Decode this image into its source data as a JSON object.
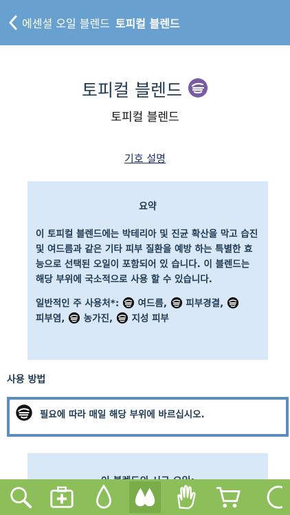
{
  "nav": {
    "back_label": "에센셜 오일 블렌드",
    "title": "토피컬 블렌드"
  },
  "header": {
    "title": "토피컬 블렌드",
    "subtitle": "토피컬 블렌드",
    "title_icon": "topical-hand-icon"
  },
  "legend_link": "기호 설명",
  "summary": {
    "heading": "요약",
    "text": "이 토피컬 블렌드에는 박테리아 및 진균 확산을 막고 습진 및 여드름과 같은 기타 피부 질환을 예방 하는 특별한 효능으로 선택된 오일이 포함되어 있 습니다. 이 블렌드는 해당 부위에 국소적으로 사용 할 수 있습니다.",
    "uses_label": "일반적인 주 사용처*:",
    "uses": [
      "여드름,",
      "피부경결,",
      "피부염,",
      "농가진,",
      "지성 피부"
    ]
  },
  "usage_section": {
    "heading": "사용 방법",
    "instruction": "필요에 따라 매일 해당 부위에 바르십시오."
  },
  "bottom_box": {
    "title": "이 블렌드의 시규 오일:"
  },
  "tabbar": {
    "tabs": [
      "search-icon",
      "first-aid-kit-icon",
      "drop-icon",
      "drops-icon",
      "hand-icon",
      "cart-icon",
      "more-icon"
    ],
    "active_index": 3
  },
  "colors": {
    "nav_bg": "#68a0cf",
    "tab_bg": "#8cbe5a",
    "summary_bg": "#d9e8f6",
    "text": "#1f3b54",
    "accent_purple": "#7a5ba0"
  }
}
